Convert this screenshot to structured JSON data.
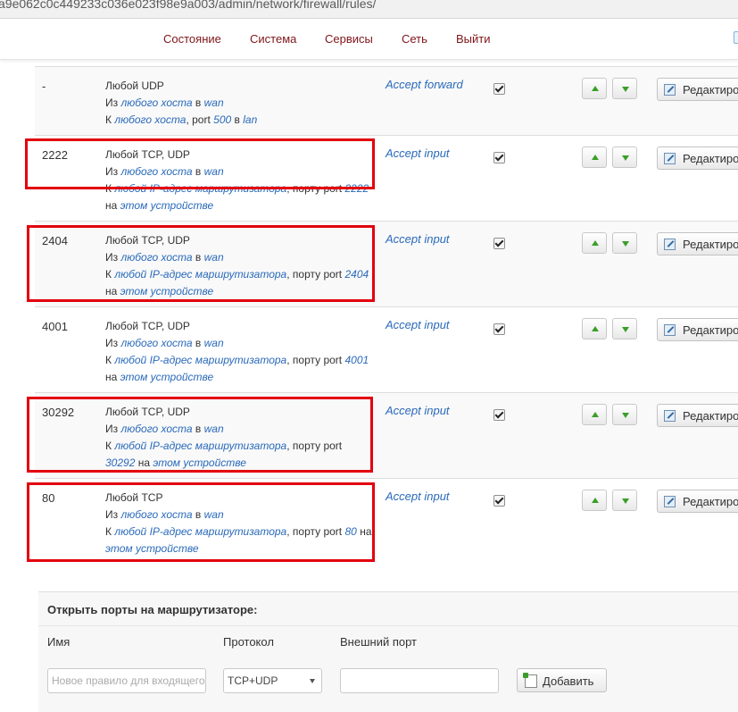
{
  "address_bar": {
    "url_text": "a9e062c0c449233c036e023f98e9a003/admin/network/firewall/rules/"
  },
  "nav": {
    "items": [
      "Состояние",
      "Система",
      "Сервисы",
      "Сеть",
      "Выйти"
    ]
  },
  "rules": [
    {
      "name": "-",
      "line1": "Любой UDP",
      "from_prefix": "Из",
      "from_host": "любого хоста",
      "in_word": "в",
      "from_zone": "wan",
      "to_prefix": "К",
      "to_host": "любого хоста",
      "port_text": ", port",
      "port": "500",
      "to_in": "в",
      "to_zone": "lan",
      "action": "Accept forward",
      "enabled": true,
      "edit_label": "Редактировать"
    },
    {
      "name": "2222",
      "line1": "Любой TCP, UDP",
      "from_prefix": "Из",
      "from_host": "любого хоста",
      "in_word": "в",
      "from_zone": "wan",
      "to_prefix": "К",
      "to_host": "любой IP-адрес маршрутизатора",
      "port_text": ", порту port",
      "port": "2222",
      "on_word": "на",
      "device": "этом устройстве",
      "action": "Accept input",
      "enabled": true,
      "edit_label": "Редактировать"
    },
    {
      "name": "2404",
      "line1": "Любой TCP, UDP",
      "from_prefix": "Из",
      "from_host": "любого хоста",
      "in_word": "в",
      "from_zone": "wan",
      "to_prefix": "К",
      "to_host": "любой IP-адрес маршрутизатора",
      "port_text": ", порту port",
      "port": "2404",
      "on_word": "на",
      "device": "этом устройстве",
      "action": "Accept input",
      "enabled": true,
      "edit_label": "Редактировать"
    },
    {
      "name": "4001",
      "line1": "Любой TCP, UDP",
      "from_prefix": "Из",
      "from_host": "любого хоста",
      "in_word": "в",
      "from_zone": "wan",
      "to_prefix": "К",
      "to_host": "любой IP-адрес маршрутизатора",
      "port_text": ", порту port",
      "port": "4001",
      "on_word": "на",
      "device": "этом устройстве",
      "action": "Accept input",
      "enabled": true,
      "edit_label": "Редактировать"
    },
    {
      "name": "30292",
      "line1": "Любой TCP, UDP",
      "from_prefix": "Из",
      "from_host": "любого хоста",
      "in_word": "в",
      "from_zone": "wan",
      "to_prefix": "К",
      "to_host": "любой IP-адрес маршрутизатора",
      "port_text": ", порту port",
      "port": "30292",
      "on_word": "на",
      "device": "этом устройстве",
      "action": "Accept input",
      "enabled": true,
      "edit_label": "Редактировать"
    },
    {
      "name": "80",
      "line1": "Любой TCP",
      "from_prefix": "Из",
      "from_host": "любого хоста",
      "in_word": "в",
      "from_zone": "wan",
      "to_prefix": "К",
      "to_host": "любой IP-адрес маршрутизатора",
      "port_text": ", порту port",
      "port": "80",
      "on_word": "на",
      "device": "этом устройстве",
      "action": "Accept input",
      "enabled": true,
      "edit_label": "Редактировать"
    }
  ],
  "open_ports": {
    "title": "Открыть порты на маршрутизаторе:",
    "col_name": "Имя",
    "col_protocol": "Протокол",
    "col_port": "Внешний порт",
    "name_placeholder": "Новое правило для входящего",
    "protocol_value": "TCP+UDP",
    "port_value": "",
    "add_label": "Добавить"
  },
  "colors": {
    "nav_link": "#7f1418",
    "link": "#2a6aba",
    "highlight": "#e3000f",
    "arrow": "#3b9e2a"
  }
}
